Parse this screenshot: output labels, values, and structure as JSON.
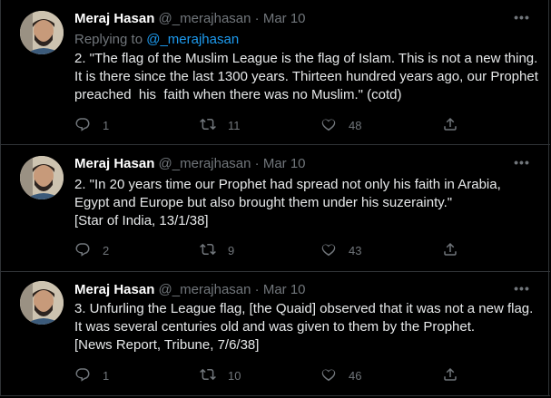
{
  "tweets": [
    {
      "name": "Meraj Hasan",
      "handle": "@_merajhasan",
      "separator": "·",
      "date": "Mar 10",
      "reply_prefix": "Replying to",
      "reply_to": "@_merajhasan",
      "lines": [
        "2. \"The flag of the Muslim League is the flag of Islam. This is not a new thing.",
        "It is there since the last 1300 years. Thirteen hundred years ago, our Prophet",
        "preached  his  faith when there was no Muslim.\" (cotd)"
      ],
      "replies": "1",
      "retweets": "11",
      "likes": "48"
    },
    {
      "name": "Meraj Hasan",
      "handle": "@_merajhasan",
      "separator": "·",
      "date": "Mar 10",
      "lines": [
        "2. \"In 20 years time our Prophet had spread not only his faith in Arabia,",
        "Egypt and Europe but also brought them under his suzerainty.\"",
        "[Star of India, 13/1/38]"
      ],
      "replies": "2",
      "retweets": "9",
      "likes": "43"
    },
    {
      "name": "Meraj Hasan",
      "handle": "@_merajhasan",
      "separator": "·",
      "date": "Mar 10",
      "lines": [
        "3. Unfurling the League flag, [the Quaid] observed that it was not a new flag.",
        "It was several centuries old and was given to them by the Prophet.",
        "[News Report, Tribune, 7/6/38]"
      ],
      "replies": "1",
      "retweets": "10",
      "likes": "46"
    }
  ],
  "icons": {
    "more": "more-dots-icon",
    "reply": "reply-icon",
    "retweet": "retweet-icon",
    "like": "heart-icon",
    "share": "share-icon"
  },
  "colors": {
    "background": "#000000",
    "accent": "#1d9bf0",
    "muted": "#71767b",
    "text": "#e7e9ea",
    "divider": "#2f3336"
  }
}
